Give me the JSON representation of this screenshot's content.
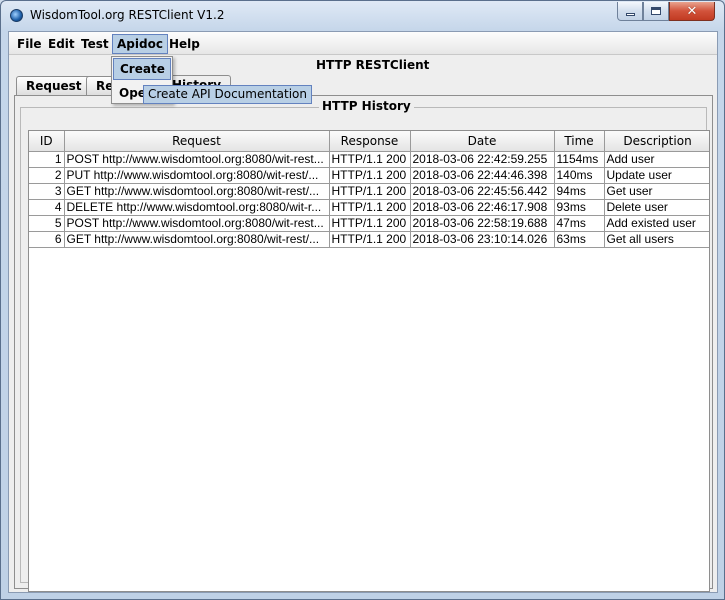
{
  "window": {
    "title": "WisdomTool.org RESTClient V1.2",
    "close_glyph": "✕"
  },
  "menubar": {
    "items": [
      "File",
      "Edit",
      "Test",
      "Apidoc",
      "Help"
    ]
  },
  "app_section": {
    "title": "HTTP RESTClient"
  },
  "tabs": [
    {
      "label": "Request",
      "selected": false
    },
    {
      "label": "Res",
      "selected": false
    },
    {
      "label": "History",
      "selected": true
    }
  ],
  "history": {
    "title": "HTTP History",
    "columns": [
      "ID",
      "Request",
      "Response",
      "Date",
      "Time",
      "Description"
    ],
    "rows": [
      [
        "1",
        "POST http://www.wisdomtool.org:8080/wit-rest...",
        "HTTP/1.1 200",
        "2018-03-06 22:42:59.255",
        "1154ms",
        "Add user"
      ],
      [
        "2",
        "PUT http://www.wisdomtool.org:8080/wit-rest/...",
        "HTTP/1.1 200",
        "2018-03-06 22:44:46.398",
        "140ms",
        "Update user"
      ],
      [
        "3",
        "GET http://www.wisdomtool.org:8080/wit-rest/...",
        "HTTP/1.1 200",
        "2018-03-06 22:45:56.442",
        "94ms",
        "Get user"
      ],
      [
        "4",
        "DELETE http://www.wisdomtool.org:8080/wit-r...",
        "HTTP/1.1 200",
        "2018-03-06 22:46:17.908",
        "93ms",
        "Delete user"
      ],
      [
        "5",
        "POST http://www.wisdomtool.org:8080/wit-rest...",
        "HTTP/1.1 200",
        "2018-03-06 22:58:19.688",
        "47ms",
        "Add existed user"
      ],
      [
        "6",
        "GET http://www.wisdomtool.org:8080/wit-rest/...",
        "HTTP/1.1 200",
        "2018-03-06 23:10:14.026",
        "63ms",
        "Get all users"
      ]
    ]
  },
  "apidoc_menu": {
    "items": [
      "Create",
      "Ope"
    ],
    "tooltip": "Create API Documentation"
  },
  "colors": {
    "highlight": "#b8cfe5",
    "highlight_border": "#6382bf",
    "close_button": "#c13b22"
  }
}
